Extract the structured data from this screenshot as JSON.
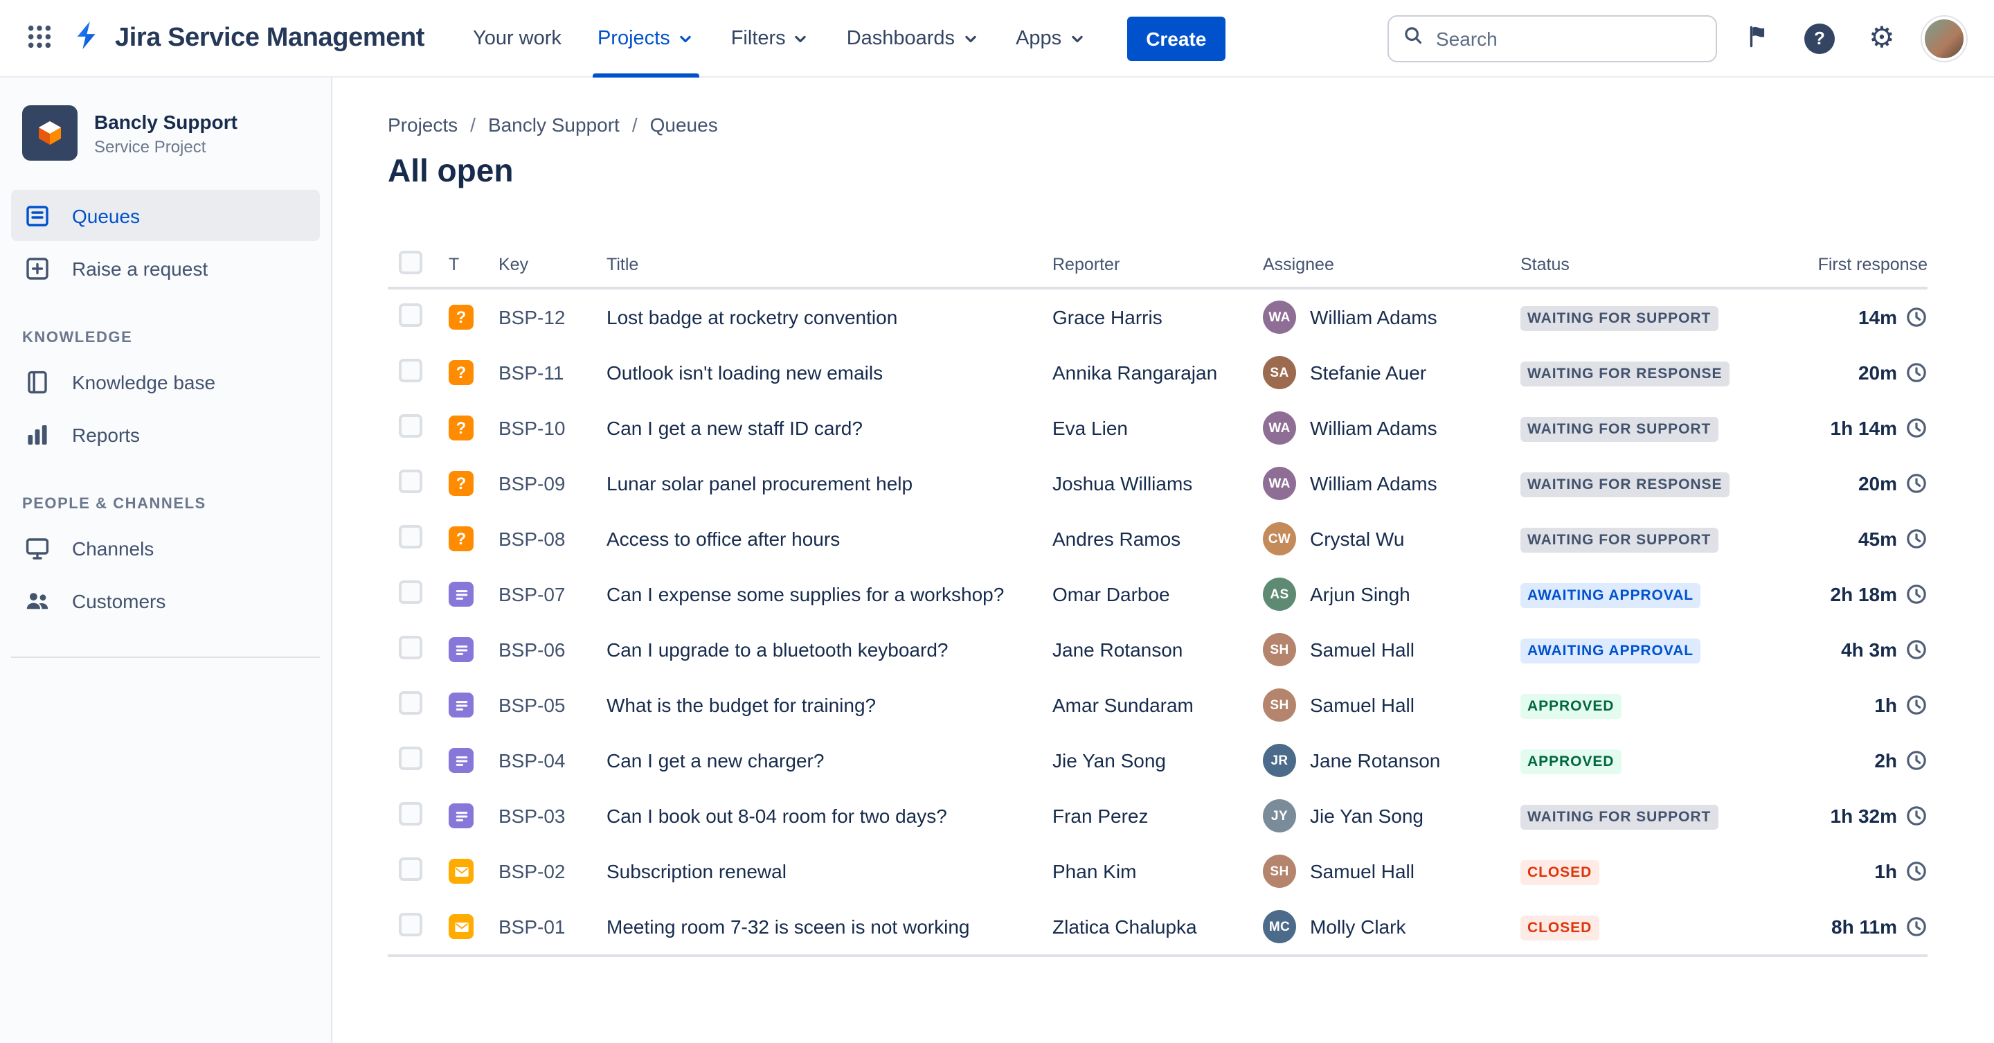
{
  "topnav": {
    "app_title": "Jira Service Management",
    "items": [
      {
        "label": "Your work",
        "caret": false,
        "active": false
      },
      {
        "label": "Projects",
        "caret": true,
        "active": true
      },
      {
        "label": "Filters",
        "caret": true,
        "active": false
      },
      {
        "label": "Dashboards",
        "caret": true,
        "active": false
      },
      {
        "label": "Apps",
        "caret": true,
        "active": false
      }
    ],
    "create_label": "Create",
    "search": {
      "placeholder": "Search"
    }
  },
  "sidebar": {
    "project": {
      "name": "Bancly Support",
      "type": "Service Project"
    },
    "primary_items": [
      {
        "label": "Queues",
        "icon": "queues-icon",
        "active": true
      },
      {
        "label": "Raise a request",
        "icon": "raise-request-icon",
        "active": false
      }
    ],
    "sections": [
      {
        "label": "KNOWLEDGE",
        "items": [
          {
            "label": "Knowledge base",
            "icon": "book-icon"
          },
          {
            "label": "Reports",
            "icon": "bar-chart-icon"
          }
        ]
      },
      {
        "label": "PEOPLE & CHANNELS",
        "items": [
          {
            "label": "Channels",
            "icon": "monitor-icon"
          },
          {
            "label": "Customers",
            "icon": "people-icon"
          }
        ]
      }
    ]
  },
  "main": {
    "breadcrumb": [
      "Projects",
      "Bancly Support",
      "Queues"
    ],
    "title": "All open"
  },
  "table": {
    "columns": [
      "T",
      "Key",
      "Title",
      "Reporter",
      "Assignee",
      "Status",
      "First response"
    ],
    "rows": [
      {
        "key": "BSP-12",
        "type": "question",
        "title": "Lost badge at rocketry convention",
        "reporter": "Grace Harris",
        "assignee": "William Adams",
        "status": "WAITING FOR SUPPORT",
        "status_type": "default",
        "first_response": "14m"
      },
      {
        "key": "BSP-11",
        "type": "question",
        "title": "Outlook isn't loading new emails",
        "reporter": "Annika Rangarajan",
        "assignee": "Stefanie Auer",
        "status": "WAITING FOR RESPONSE",
        "status_type": "default",
        "first_response": "20m"
      },
      {
        "key": "BSP-10",
        "type": "question",
        "title": "Can I get a new staff ID card?",
        "reporter": "Eva Lien",
        "assignee": "William Adams",
        "status": "WAITING FOR SUPPORT",
        "status_type": "default",
        "first_response": "1h 14m"
      },
      {
        "key": "BSP-09",
        "type": "question",
        "title": "Lunar solar panel procurement help",
        "reporter": "Joshua Williams",
        "assignee": "William Adams",
        "status": "WAITING FOR RESPONSE",
        "status_type": "default",
        "first_response": "20m"
      },
      {
        "key": "BSP-08",
        "type": "question",
        "title": "Access to office after hours",
        "reporter": "Andres Ramos",
        "assignee": "Crystal Wu",
        "status": "WAITING FOR SUPPORT",
        "status_type": "default",
        "first_response": "45m"
      },
      {
        "key": "BSP-07",
        "type": "task",
        "title": "Can I expense some supplies for a workshop?",
        "reporter": "Omar Darboe",
        "assignee": "Arjun Singh",
        "status": "AWAITING APPROVAL",
        "status_type": "inprogress",
        "first_response": "2h 18m"
      },
      {
        "key": "BSP-06",
        "type": "task",
        "title": "Can I upgrade to a bluetooth keyboard?",
        "reporter": "Jane Rotanson",
        "assignee": "Samuel Hall",
        "status": "AWAITING APPROVAL",
        "status_type": "inprogress",
        "first_response": "4h 3m"
      },
      {
        "key": "BSP-05",
        "type": "task",
        "title": "What is the budget for training?",
        "reporter": "Amar Sundaram",
        "assignee": "Samuel Hall",
        "status": "APPROVED",
        "status_type": "success",
        "first_response": "1h"
      },
      {
        "key": "BSP-04",
        "type": "task",
        "title": "Can I get a new charger?",
        "reporter": "Jie Yan Song",
        "assignee": "Jane Rotanson",
        "status": "APPROVED",
        "status_type": "success",
        "first_response": "2h"
      },
      {
        "key": "BSP-03",
        "type": "task",
        "title": "Can I book out 8-04 room for two days?",
        "reporter": "Fran Perez",
        "assignee": "Jie Yan Song",
        "status": "WAITING FOR SUPPORT",
        "status_type": "default",
        "first_response": "1h 32m"
      },
      {
        "key": "BSP-02",
        "type": "email",
        "title": "Subscription renewal",
        "reporter": "Phan Kim",
        "assignee": "Samuel Hall",
        "status": "CLOSED",
        "status_type": "danger",
        "first_response": "1h"
      },
      {
        "key": "BSP-01",
        "type": "email",
        "title": "Meeting room 7-32 is sceen is not working",
        "reporter": "Zlatica Chalupka",
        "assignee": "Molly Clark",
        "status": "CLOSED",
        "status_type": "danger",
        "first_response": "8h 11m"
      }
    ]
  },
  "colors": {
    "accent": "#0052CC",
    "status_default": {
      "bg": "#DFE1E6",
      "fg": "#42526E"
    },
    "status_inprogress": {
      "bg": "#DEEBFF",
      "fg": "#0052CC"
    },
    "status_success": {
      "bg": "#E3FCEF",
      "fg": "#006644"
    },
    "status_danger": {
      "bg": "#FFEBE6",
      "fg": "#DE350B"
    },
    "type_question": "#FF8B00",
    "type_task": "#8777D9",
    "type_email": "#FFAB00"
  }
}
